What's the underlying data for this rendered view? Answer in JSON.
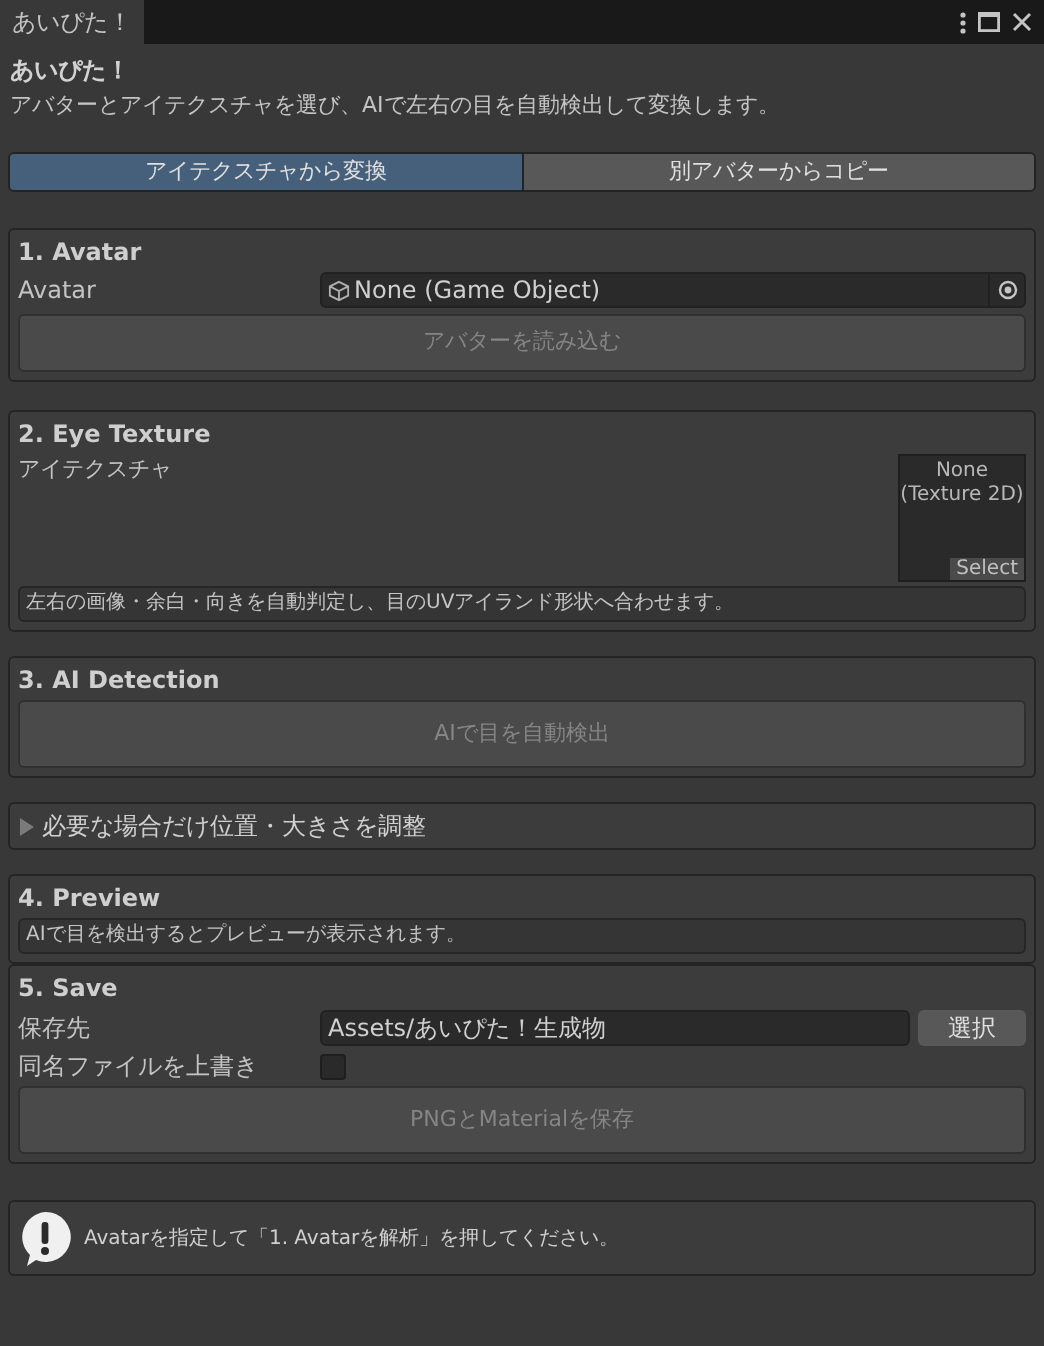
{
  "window": {
    "tab_title": "あいぴた！"
  },
  "header": {
    "title": "あいぴた！",
    "description": "アバターとアイテクスチャを選び、AIで左右の目を自動検出して変換します。"
  },
  "mode_tabs": [
    {
      "label": "アイテクスチャから変換",
      "selected": true
    },
    {
      "label": "別アバターからコピー",
      "selected": false
    }
  ],
  "avatar_section": {
    "title": "1. Avatar",
    "field_label": "Avatar",
    "field_value": "None (Game Object)",
    "button": {
      "label": "アバターを読み込む",
      "disabled": true
    }
  },
  "texture_section": {
    "title": "2. Eye Texture",
    "field_label": "アイテクスチャ",
    "slot_text": "None\n(Texture 2D)",
    "slot_button": "Select",
    "note": "左右の画像・余白・向きを自動判定し、目のUVアイランド形状へ合わせます。"
  },
  "detection_section": {
    "title": "3. AI Detection",
    "button": {
      "label": "AIで目を自動検出",
      "disabled": true
    }
  },
  "adjust_foldout": {
    "label": "必要な場合だけ位置・大きさを調整",
    "expanded": false
  },
  "preview_section": {
    "title": "4. Preview",
    "note": "AIで目を検出するとプレビューが表示されます。"
  },
  "save_section": {
    "title": "5. Save",
    "path_label": "保存先",
    "path_value": "Assets/あいぴた！生成物",
    "browse_button": "選択",
    "overwrite_label": "同名ファイルを上書き",
    "overwrite_checked": false,
    "button": {
      "label": "PNGとMaterialを保存",
      "disabled": true
    }
  },
  "help_box": {
    "message": "Avatarを指定して「1. Avatarを解析」を押してください。"
  }
}
